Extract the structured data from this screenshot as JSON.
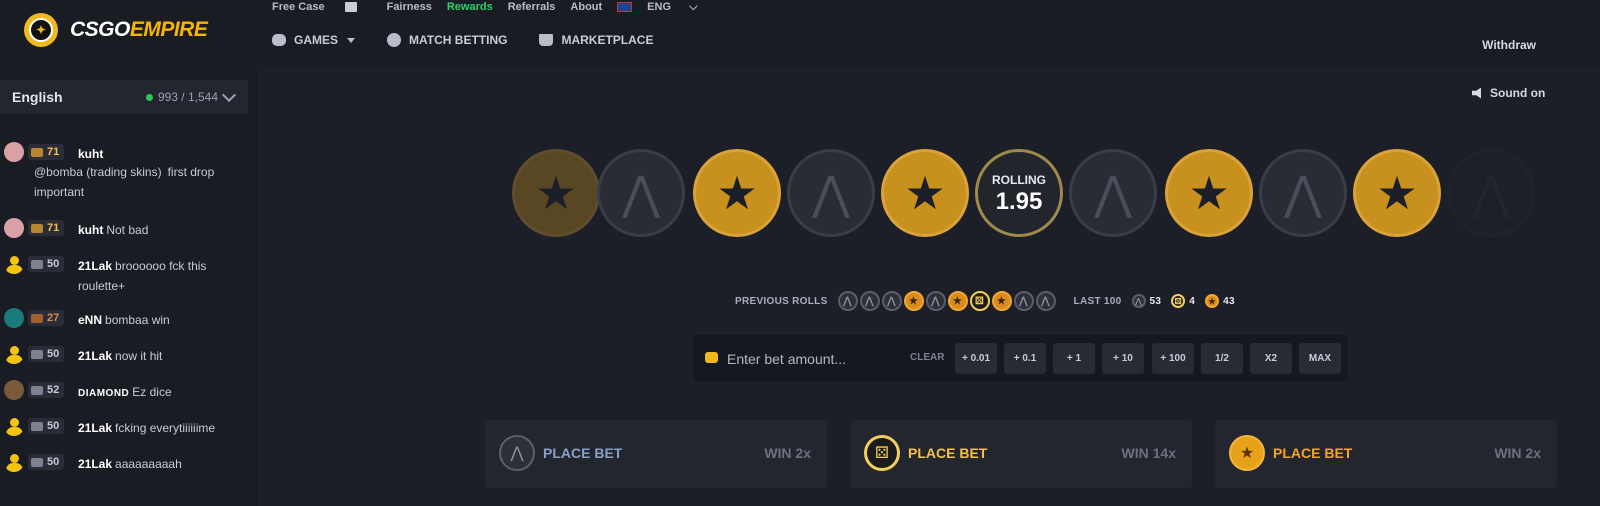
{
  "brand": {
    "part1": "CSGO",
    "part2": "EMPIRE"
  },
  "top_links": {
    "free_case": "Free Case",
    "fairness": "Fairness",
    "rewards": "Rewards",
    "referrals": "Referrals",
    "about": "About",
    "language": "ENG"
  },
  "nav": {
    "games": "GAMES",
    "match_betting": "MATCH BETTING",
    "marketplace": "MARKETPLACE",
    "withdraw": "Withdraw"
  },
  "sound": {
    "label": "Sound on"
  },
  "chat_header": {
    "language": "English",
    "online": "993 / 1,544"
  },
  "chat": [
    {
      "avatar": "pink",
      "rank": "gold",
      "level": "71",
      "user": "kuht",
      "mention": "@bomba (trading skins)",
      "text": "first drop important"
    },
    {
      "avatar": "pink",
      "rank": "gold",
      "level": "71",
      "user": "kuht",
      "text": "Not bad"
    },
    {
      "avatar": "default",
      "rank": "silver",
      "level": "50",
      "user": "21Lak",
      "text": "broooooo fck this roulette+"
    },
    {
      "avatar": "teal",
      "rank": "bronze",
      "level": "27",
      "user": "eNN",
      "text": "bombaa win"
    },
    {
      "avatar": "default",
      "rank": "silver",
      "level": "50",
      "user": "21Lak",
      "text": "now it hit"
    },
    {
      "avatar": "brown",
      "rank": "silver",
      "level": "52",
      "user": "DIAMOND",
      "text": "Ez dice"
    },
    {
      "avatar": "default",
      "rank": "silver",
      "level": "50",
      "user": "21Lak",
      "text": "fcking everytiiiiiime"
    },
    {
      "avatar": "default",
      "rank": "silver",
      "level": "50",
      "user": "21Lak",
      "text": "aaaaaaaaah"
    }
  ],
  "roulette": {
    "status_label": "ROLLING",
    "timer": "1.95",
    "reel": [
      "t",
      "ct",
      "t",
      "ct",
      "t",
      "dice",
      "ct",
      "t",
      "ct",
      "t",
      "ct"
    ]
  },
  "previous_rolls": {
    "label": "PREVIOUS ROLLS",
    "rolls": [
      "ct",
      "ct",
      "ct",
      "t",
      "ct",
      "t",
      "dice",
      "t",
      "ct",
      "ct"
    ],
    "last_label": "LAST 100",
    "ct_count": "53",
    "dice_count": "4",
    "t_count": "43"
  },
  "bet": {
    "placeholder": "Enter bet amount...",
    "clear": "CLEAR",
    "buttons": [
      "+ 0.01",
      "+ 0.1",
      "+ 1",
      "+ 10",
      "+ 100",
      "1/2",
      "X2",
      "MAX"
    ]
  },
  "panels": [
    {
      "type": "ct",
      "label": "PLACE BET",
      "win": "WIN 2x",
      "color": "#8aa0c8"
    },
    {
      "type": "dice",
      "label": "PLACE BET",
      "win": "WIN 14x",
      "color": "#f5c14a"
    },
    {
      "type": "t",
      "label": "PLACE BET",
      "win": "WIN 2x",
      "color": "#f5a524"
    }
  ],
  "icons": {
    "ct": "counter-terrorist-icon",
    "t": "terrorist-icon",
    "dice": "dice-icon"
  },
  "colors": {
    "accent": "#f7b500",
    "rewards": "#2ad36b",
    "online": "#2dc653"
  }
}
